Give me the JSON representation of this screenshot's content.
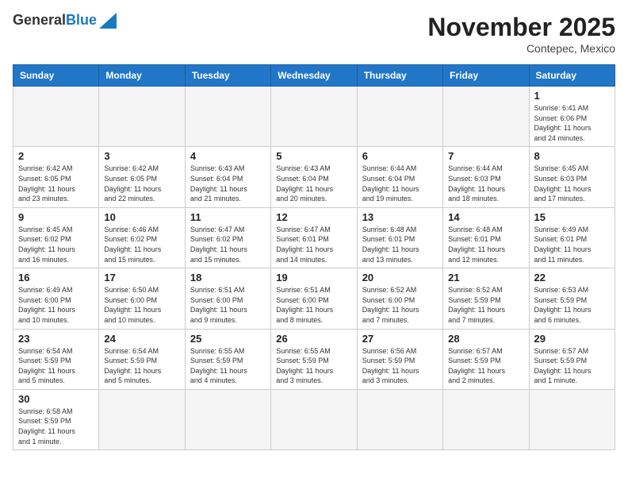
{
  "header": {
    "logo_general": "General",
    "logo_blue": "Blue",
    "month_title": "November 2025",
    "subtitle": "Contepec, Mexico"
  },
  "days_of_week": [
    "Sunday",
    "Monday",
    "Tuesday",
    "Wednesday",
    "Thursday",
    "Friday",
    "Saturday"
  ],
  "weeks": [
    [
      {
        "day": "",
        "info": ""
      },
      {
        "day": "",
        "info": ""
      },
      {
        "day": "",
        "info": ""
      },
      {
        "day": "",
        "info": ""
      },
      {
        "day": "",
        "info": ""
      },
      {
        "day": "",
        "info": ""
      },
      {
        "day": "1",
        "info": "Sunrise: 6:41 AM\nSunset: 6:06 PM\nDaylight: 11 hours\nand 24 minutes."
      }
    ],
    [
      {
        "day": "2",
        "info": "Sunrise: 6:42 AM\nSunset: 6:05 PM\nDaylight: 11 hours\nand 23 minutes."
      },
      {
        "day": "3",
        "info": "Sunrise: 6:42 AM\nSunset: 6:05 PM\nDaylight: 11 hours\nand 22 minutes."
      },
      {
        "day": "4",
        "info": "Sunrise: 6:43 AM\nSunset: 6:04 PM\nDaylight: 11 hours\nand 21 minutes."
      },
      {
        "day": "5",
        "info": "Sunrise: 6:43 AM\nSunset: 6:04 PM\nDaylight: 11 hours\nand 20 minutes."
      },
      {
        "day": "6",
        "info": "Sunrise: 6:44 AM\nSunset: 6:04 PM\nDaylight: 11 hours\nand 19 minutes."
      },
      {
        "day": "7",
        "info": "Sunrise: 6:44 AM\nSunset: 6:03 PM\nDaylight: 11 hours\nand 18 minutes."
      },
      {
        "day": "8",
        "info": "Sunrise: 6:45 AM\nSunset: 6:03 PM\nDaylight: 11 hours\nand 17 minutes."
      }
    ],
    [
      {
        "day": "9",
        "info": "Sunrise: 6:45 AM\nSunset: 6:02 PM\nDaylight: 11 hours\nand 16 minutes."
      },
      {
        "day": "10",
        "info": "Sunrise: 6:46 AM\nSunset: 6:02 PM\nDaylight: 11 hours\nand 15 minutes."
      },
      {
        "day": "11",
        "info": "Sunrise: 6:47 AM\nSunset: 6:02 PM\nDaylight: 11 hours\nand 15 minutes."
      },
      {
        "day": "12",
        "info": "Sunrise: 6:47 AM\nSunset: 6:01 PM\nDaylight: 11 hours\nand 14 minutes."
      },
      {
        "day": "13",
        "info": "Sunrise: 6:48 AM\nSunset: 6:01 PM\nDaylight: 11 hours\nand 13 minutes."
      },
      {
        "day": "14",
        "info": "Sunrise: 6:48 AM\nSunset: 6:01 PM\nDaylight: 11 hours\nand 12 minutes."
      },
      {
        "day": "15",
        "info": "Sunrise: 6:49 AM\nSunset: 6:01 PM\nDaylight: 11 hours\nand 11 minutes."
      }
    ],
    [
      {
        "day": "16",
        "info": "Sunrise: 6:49 AM\nSunset: 6:00 PM\nDaylight: 11 hours\nand 10 minutes."
      },
      {
        "day": "17",
        "info": "Sunrise: 6:50 AM\nSunset: 6:00 PM\nDaylight: 11 hours\nand 10 minutes."
      },
      {
        "day": "18",
        "info": "Sunrise: 6:51 AM\nSunset: 6:00 PM\nDaylight: 11 hours\nand 9 minutes."
      },
      {
        "day": "19",
        "info": "Sunrise: 6:51 AM\nSunset: 6:00 PM\nDaylight: 11 hours\nand 8 minutes."
      },
      {
        "day": "20",
        "info": "Sunrise: 6:52 AM\nSunset: 6:00 PM\nDaylight: 11 hours\nand 7 minutes."
      },
      {
        "day": "21",
        "info": "Sunrise: 6:52 AM\nSunset: 5:59 PM\nDaylight: 11 hours\nand 7 minutes."
      },
      {
        "day": "22",
        "info": "Sunrise: 6:53 AM\nSunset: 5:59 PM\nDaylight: 11 hours\nand 6 minutes."
      }
    ],
    [
      {
        "day": "23",
        "info": "Sunrise: 6:54 AM\nSunset: 5:59 PM\nDaylight: 11 hours\nand 5 minutes."
      },
      {
        "day": "24",
        "info": "Sunrise: 6:54 AM\nSunset: 5:59 PM\nDaylight: 11 hours\nand 5 minutes."
      },
      {
        "day": "25",
        "info": "Sunrise: 6:55 AM\nSunset: 5:59 PM\nDaylight: 11 hours\nand 4 minutes."
      },
      {
        "day": "26",
        "info": "Sunrise: 6:55 AM\nSunset: 5:59 PM\nDaylight: 11 hours\nand 3 minutes."
      },
      {
        "day": "27",
        "info": "Sunrise: 6:56 AM\nSunset: 5:59 PM\nDaylight: 11 hours\nand 3 minutes."
      },
      {
        "day": "28",
        "info": "Sunrise: 6:57 AM\nSunset: 5:59 PM\nDaylight: 11 hours\nand 2 minutes."
      },
      {
        "day": "29",
        "info": "Sunrise: 6:57 AM\nSunset: 5:59 PM\nDaylight: 11 hours\nand 1 minute."
      }
    ],
    [
      {
        "day": "30",
        "info": "Sunrise: 6:58 AM\nSunset: 5:59 PM\nDaylight: 11 hours\nand 1 minute."
      },
      {
        "day": "",
        "info": ""
      },
      {
        "day": "",
        "info": ""
      },
      {
        "day": "",
        "info": ""
      },
      {
        "day": "",
        "info": ""
      },
      {
        "day": "",
        "info": ""
      },
      {
        "day": "",
        "info": ""
      }
    ]
  ]
}
